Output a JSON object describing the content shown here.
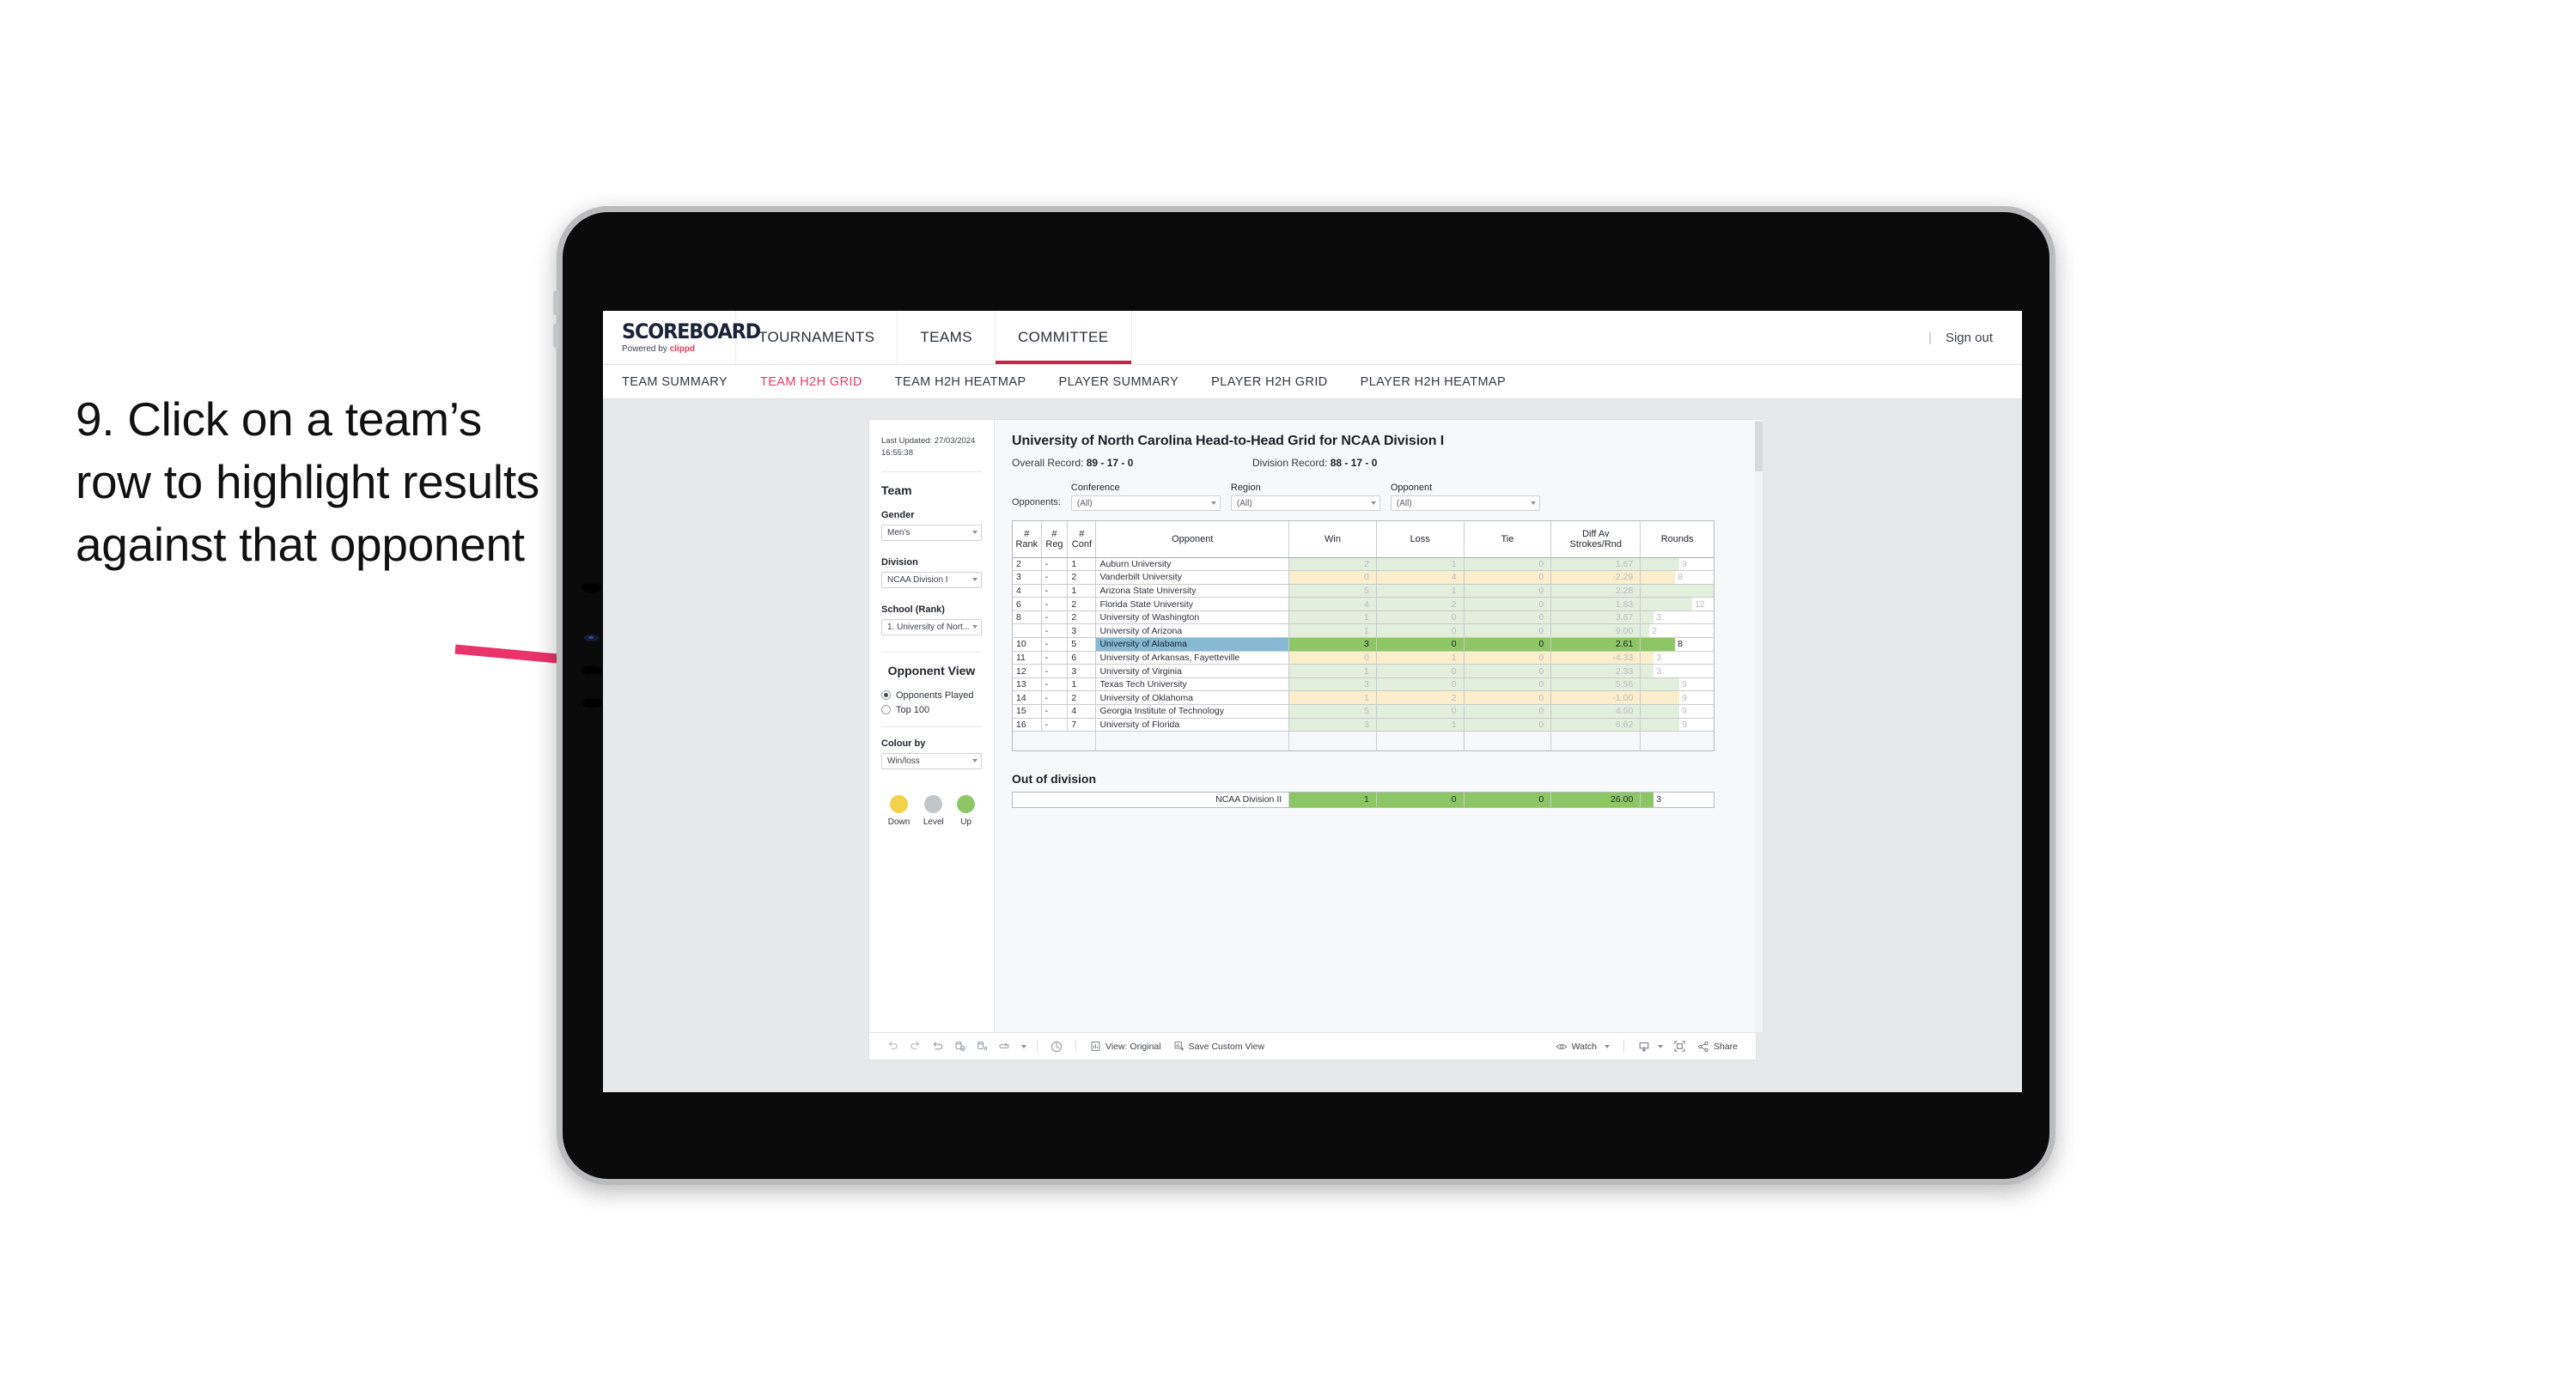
{
  "annotation": {
    "text": "9. Click on a team’s row to highlight results against that opponent"
  },
  "app": {
    "logo_word": "SCOREBOARD",
    "logo_powered": "Powered by",
    "logo_brand": "clippd",
    "top_tabs": [
      {
        "label": "TOURNAMENTS",
        "active": false
      },
      {
        "label": "TEAMS",
        "active": false
      },
      {
        "label": "COMMITTEE",
        "active": true
      }
    ],
    "divider": "|",
    "sign_out": "Sign out",
    "subnav": [
      {
        "label": "TEAM SUMMARY",
        "active": false
      },
      {
        "label": "TEAM H2H GRID",
        "active": true
      },
      {
        "label": "TEAM H2H HEATMAP",
        "active": false
      },
      {
        "label": "PLAYER SUMMARY",
        "active": false
      },
      {
        "label": "PLAYER H2H GRID",
        "active": false
      },
      {
        "label": "PLAYER H2H HEATMAP",
        "active": false
      }
    ]
  },
  "sidebar": {
    "last_updated": "Last Updated: 27/03/2024 16:55:38",
    "team_heading": "Team",
    "gender_label": "Gender",
    "gender_value": "Men’s",
    "division_label": "Division",
    "division_value": "NCAA Division I",
    "school_label": "School (Rank)",
    "school_value": "1. University of Nort...",
    "opponent_view_heading": "Opponent View",
    "opponent_view_options": [
      {
        "label": "Opponents Played",
        "selected": true
      },
      {
        "label": "Top 100",
        "selected": false
      }
    ],
    "colour_by_label": "Colour by",
    "colour_by_value": "Win/loss",
    "legend": [
      {
        "label": "Down",
        "color": "#f2d14b"
      },
      {
        "label": "Level",
        "color": "#c3c6c9"
      },
      {
        "label": "Up",
        "color": "#8cc665"
      }
    ]
  },
  "main": {
    "title": "University of North Carolina Head-to-Head Grid for NCAA Division I",
    "overall_record_label": "Overall Record:",
    "overall_record_value": "89 - 17 - 0",
    "division_record_label": "Division Record:",
    "division_record_value": "88 - 17 - 0",
    "opponents_label": "Opponents:",
    "filters": [
      {
        "label": "Conference",
        "value": "(All)"
      },
      {
        "label": "Region",
        "value": "(All)"
      },
      {
        "label": "Opponent",
        "value": "(All)"
      }
    ],
    "out_of_division_title": "Out of division"
  },
  "chart_data": {
    "type": "table",
    "title": "University of North Carolina Head-to-Head Grid for NCAA Division I",
    "columns": [
      "# Rank",
      "# Reg",
      "# Conf",
      "Opponent",
      "Win",
      "Loss",
      "Tie",
      "Diff Av Strokes/Rnd",
      "Rounds"
    ],
    "rounds_max": 17,
    "rows": [
      {
        "rank": "2",
        "reg": "-",
        "conf": "1",
        "opponent": "Auburn University",
        "win": "2",
        "loss": "1",
        "tie": "0",
        "diff": "1.67",
        "rounds": "9",
        "tone": "up",
        "selected": false
      },
      {
        "rank": "3",
        "reg": "-",
        "conf": "2",
        "opponent": "Vanderbilt University",
        "win": "0",
        "loss": "4",
        "tie": "0",
        "diff": "-2.29",
        "rounds": "8",
        "tone": "down",
        "selected": false
      },
      {
        "rank": "4",
        "reg": "-",
        "conf": "1",
        "opponent": "Arizona State University",
        "win": "5",
        "loss": "1",
        "tie": "0",
        "diff": "2.28",
        "rounds": "17",
        "tone": "up",
        "selected": false
      },
      {
        "rank": "6",
        "reg": "-",
        "conf": "2",
        "opponent": "Florida State University",
        "win": "4",
        "loss": "2",
        "tie": "0",
        "diff": "1.83",
        "rounds": "12",
        "tone": "up",
        "selected": false
      },
      {
        "rank": "8",
        "reg": "-",
        "conf": "2",
        "opponent": "University of Washington",
        "win": "1",
        "loss": "0",
        "tie": "0",
        "diff": "3.67",
        "rounds": "3",
        "tone": "up",
        "selected": false
      },
      {
        "rank": "",
        "reg": "-",
        "conf": "3",
        "opponent": "University of Arizona",
        "win": "1",
        "loss": "0",
        "tie": "0",
        "diff": "9.00",
        "rounds": "2",
        "tone": "up",
        "selected": false
      },
      {
        "rank": "10",
        "reg": "-",
        "conf": "5",
        "opponent": "University of Alabama",
        "win": "3",
        "loss": "0",
        "tie": "0",
        "diff": "2.61",
        "rounds": "8",
        "tone": "up-sel",
        "selected": true
      },
      {
        "rank": "11",
        "reg": "-",
        "conf": "6",
        "opponent": "University of Arkansas, Fayetteville",
        "win": "0",
        "loss": "1",
        "tie": "0",
        "diff": "-4.33",
        "rounds": "3",
        "tone": "down",
        "selected": false
      },
      {
        "rank": "12",
        "reg": "-",
        "conf": "3",
        "opponent": "University of Virginia",
        "win": "1",
        "loss": "0",
        "tie": "0",
        "diff": "2.33",
        "rounds": "3",
        "tone": "up",
        "selected": false
      },
      {
        "rank": "13",
        "reg": "-",
        "conf": "1",
        "opponent": "Texas Tech University",
        "win": "3",
        "loss": "0",
        "tie": "0",
        "diff": "5.56",
        "rounds": "9",
        "tone": "up",
        "selected": false
      },
      {
        "rank": "14",
        "reg": "-",
        "conf": "2",
        "opponent": "University of Oklahoma",
        "win": "1",
        "loss": "2",
        "tie": "0",
        "diff": "-1.00",
        "rounds": "9",
        "tone": "down",
        "selected": false
      },
      {
        "rank": "15",
        "reg": "-",
        "conf": "4",
        "opponent": "Georgia Institute of Technology",
        "win": "5",
        "loss": "0",
        "tie": "0",
        "diff": "4.50",
        "rounds": "9",
        "tone": "up",
        "selected": false
      },
      {
        "rank": "16",
        "reg": "-",
        "conf": "7",
        "opponent": "University of Florida",
        "win": "3",
        "loss": "1",
        "tie": "0",
        "diff": "6.62",
        "rounds": "9",
        "tone": "up",
        "selected": false
      }
    ],
    "out_of_division": [
      {
        "opponent": "NCAA Division II",
        "win": "1",
        "loss": "0",
        "tie": "0",
        "diff": "26.00",
        "rounds": "3",
        "tone": "up-sel",
        "selected": false
      }
    ]
  },
  "toolbar": {
    "view_label": "View: Original",
    "save_label": "Save Custom View",
    "watch_label": "Watch",
    "share_label": "Share"
  }
}
